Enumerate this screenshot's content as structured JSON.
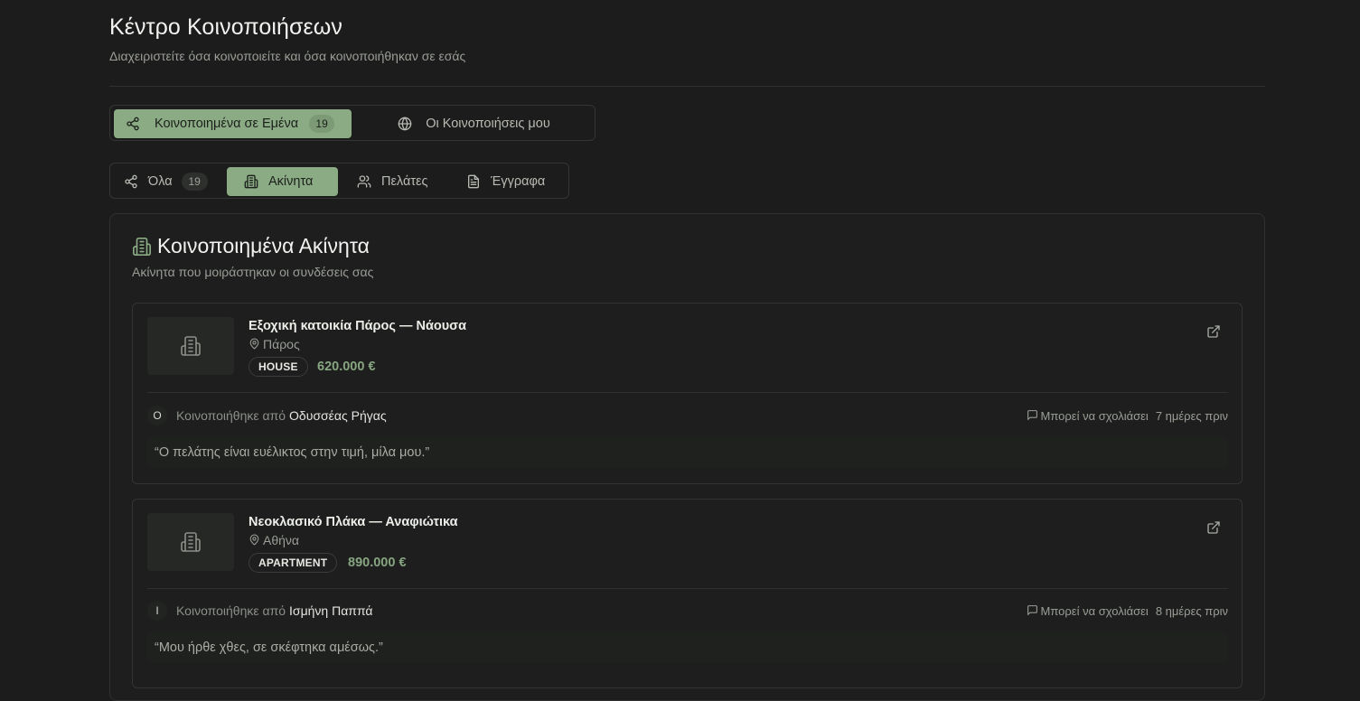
{
  "header": {
    "title": "Κέντρο Κοινοποιήσεων",
    "subtitle": "Διαχειριστείτε όσα κοινοποιείτε και όσα κοινοποιήθηκαν σε εσάς"
  },
  "segment": {
    "shared_with_me": {
      "label": "Κοινοποιημένα σε Εμένα",
      "count": "19",
      "icon": "share-icon"
    },
    "my_shares": {
      "label": "Οι Κοινοποιήσεις μου",
      "icon": "globe-icon"
    }
  },
  "tabs": [
    {
      "label": "Όλα",
      "count": "19",
      "icon": "share-icon"
    },
    {
      "label": "Ακίνητα",
      "icon": "building-icon"
    },
    {
      "label": "Πελάτες",
      "icon": "users-icon"
    },
    {
      "label": "Έγγραφα",
      "icon": "document-icon"
    }
  ],
  "panel": {
    "title": "Κοινοποιημένα Ακίνητα",
    "subtitle": "Ακίνητα που μοιράστηκαν οι συνδέσεις σας"
  },
  "properties": [
    {
      "name": "Εξοχική κατοικία Πάρος — Νάουσα",
      "location": "Πάρος",
      "type": "HOUSE",
      "price": "620.000 €",
      "shared_label": "Κοινοποιήθηκε από",
      "shared_by": "Οδυσσέας Ρήγας",
      "avatar_initial": "Ο",
      "permission": "Μπορεί να σχολιάσει",
      "time": "7 ημέρες πριν",
      "note": "“Ο πελάτης είναι ευέλικτος στην τιμή, μίλα μου.”"
    },
    {
      "name": "Νεοκλασικό Πλάκα — Αναφιώτικα",
      "location": "Αθήνα",
      "type": "APARTMENT",
      "price": "890.000 €",
      "shared_label": "Κοινοποιήθηκε από",
      "shared_by": "Ισμήνη Παππά",
      "avatar_initial": "Ι",
      "permission": "Μπορεί να σχολιάσει",
      "time": "8 ημέρες πριν",
      "note": "“Μου ήρθε χθες, σε σκέφτηκα αμέσως.”"
    }
  ],
  "colors": {
    "accent": "#8bab85",
    "price": "#86a580",
    "background": "#1b1c1b"
  }
}
